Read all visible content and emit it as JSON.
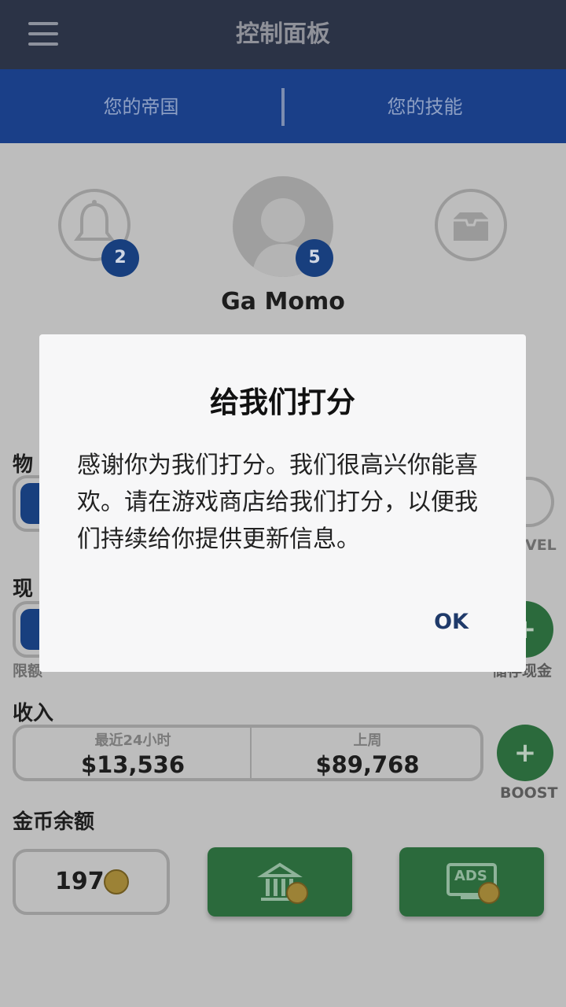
{
  "header": {
    "title": "控制面板",
    "menu_icon": "hamburger-menu-icon"
  },
  "tabs": [
    {
      "label": "您的帝国"
    },
    {
      "label": "您的技能"
    }
  ],
  "profile": {
    "notifications_badge": "2",
    "avatar_badge": "5",
    "name": "Ga Momo",
    "icons": [
      "bell-icon",
      "avatar",
      "inbox-icon"
    ]
  },
  "sections": {
    "items_label": "物",
    "level_label": "VEL",
    "cash_label": "现",
    "limit_label": "限额",
    "deposit_label": "储存现金",
    "income_label": "收入",
    "income_last24_label": "最近24小时",
    "income_last24_value": "$13,536",
    "income_lastweek_label": "上周",
    "income_lastweek_value": "$89,768",
    "boost_label": "BOOST",
    "boost_symbol": "+",
    "cash_symbol": "+",
    "coins_label": "金币余额",
    "coins_value": "197",
    "ads_label": "ADS"
  },
  "dialog": {
    "title": "给我们打分",
    "message": "感谢你为我们打分。我们很高兴你能喜欢。请在游戏商店给我们打分，以便我们持续给你提供更新信息。",
    "ok_label": "OK"
  },
  "colors": {
    "header": "#2b3346",
    "tabbar": "#1a3f88",
    "accent_green": "#2b6a3c",
    "badge": "#183f7e",
    "overlay_bg": "#bdbdbd"
  }
}
